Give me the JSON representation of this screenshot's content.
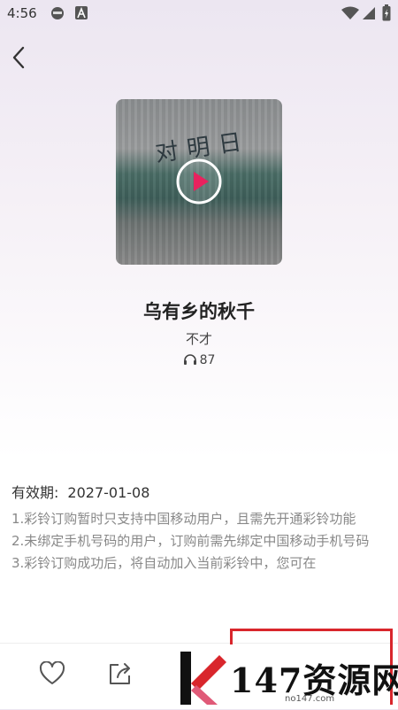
{
  "status_bar": {
    "time": "4:56"
  },
  "song": {
    "cover_text": "对明日",
    "title": "乌有乡的秋千",
    "artist": "不才",
    "play_count": "87"
  },
  "details": {
    "validity_label": "有效期:",
    "validity_value": "2027-01-08",
    "notes": [
      "1.彩铃订购暂时只支持中国移动用户，且需先开通彩铃功能",
      "2.未绑定手机号码的用户，订购前需先绑定中国移动手机号码",
      "3.彩铃订购成功后，将自动加入当前彩铃中，您可在"
    ]
  },
  "watermark": {
    "text": "147资源网",
    "sub": "no147.com"
  },
  "colors": {
    "play_accent": "#e8225e",
    "watermark_red": "#d9262c"
  }
}
